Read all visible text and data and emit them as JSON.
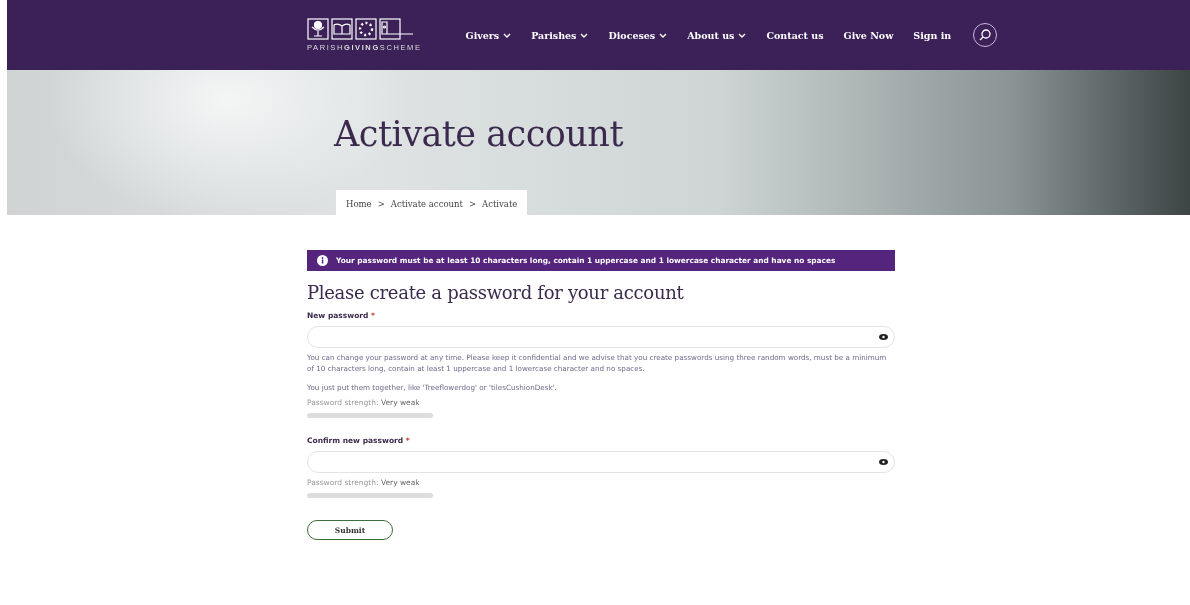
{
  "header": {
    "logo_text": "PARISH**GIVING**SCHEME",
    "nav": [
      {
        "label": "Givers",
        "dropdown": true
      },
      {
        "label": "Parishes",
        "dropdown": true
      },
      {
        "label": "Dioceses",
        "dropdown": true
      },
      {
        "label": "About us",
        "dropdown": true
      },
      {
        "label": "Contact us",
        "dropdown": false
      },
      {
        "label": "Give Now",
        "dropdown": false
      },
      {
        "label": "Sign in",
        "dropdown": false
      }
    ]
  },
  "hero": {
    "title": "Activate account",
    "breadcrumb": [
      "Home",
      "Activate account",
      "Activate"
    ],
    "separator": ">"
  },
  "notice": "Your password must be at least 10 characters long, contain 1 uppercase and 1 lowercase character and have no spaces",
  "heading": "Please create a password for your account",
  "fields": [
    {
      "label": "New password",
      "required_mark": "*",
      "help": [
        "You can change your password at any time. Please keep it confidential and we advise that you create passwords using three random words, must be a minimum of 10 characters long, contain at least 1 uppercase and 1 lowercase character and no spaces.",
        "You just put them together, like 'Treeflowerdog' or 'tilesCushionDesk'."
      ],
      "strength_label": "Password strength:",
      "strength_value": "Very weak"
    },
    {
      "label": "Confirm new password",
      "required_mark": "*",
      "strength_label": "Password strength:",
      "strength_value": "Very weak"
    }
  ],
  "submit": "Submit"
}
